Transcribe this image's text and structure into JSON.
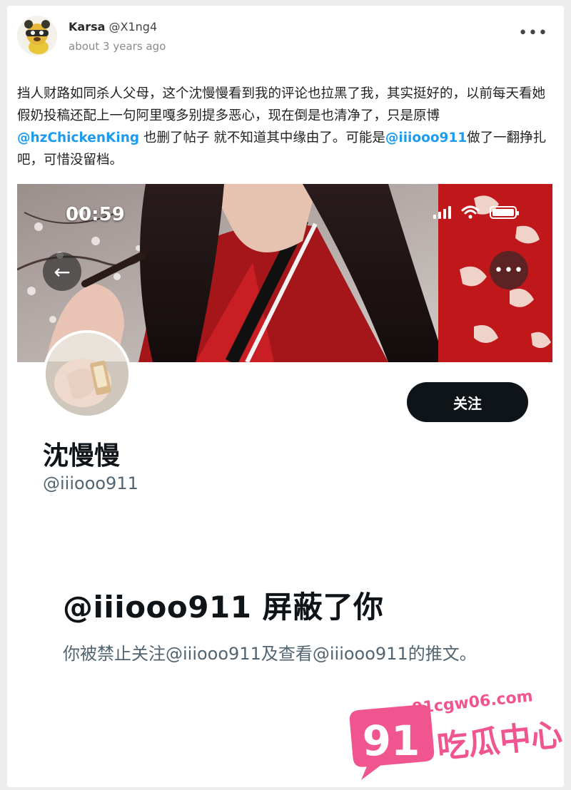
{
  "post": {
    "author_name": "Karsa",
    "author_handle": "@X1ng4",
    "timestamp": "about 3 years ago",
    "more_label": "•••",
    "text": {
      "part1": "挡人财路如同杀人父母，这个沈慢慢看到我的评论也拉黑了我，其实挺好的，以前每天看她假奶投稿还配上一句阿里嘎多别提多恶心，现在倒是也清净了，只是原博",
      "mention1": "@hzChickenKing",
      "part2": " 也删了帖子 就不知道其中缘由了。可能是",
      "mention2": "@iiiooo911",
      "part3": "做了一翻挣扎吧，可惜没留档。"
    }
  },
  "screenshot": {
    "status_time": "00:59",
    "back_icon": "←",
    "more_icon": "•••",
    "follow_label": "关注",
    "display_name": "沈慢慢",
    "handle": "@iiiooo911",
    "blocked_title": "@iiiooo911 屏蔽了你",
    "blocked_desc": "你被禁止关注@iiiooo911及查看@iiiooo911的推文。"
  },
  "watermark": {
    "number": "91",
    "domain": "91cgw06.com",
    "brand": "吃瓜中心"
  },
  "colors": {
    "mention": "#1d9bf0",
    "follow_bg": "#0f1419",
    "muted": "#536471",
    "watermark": "#f0558f"
  }
}
